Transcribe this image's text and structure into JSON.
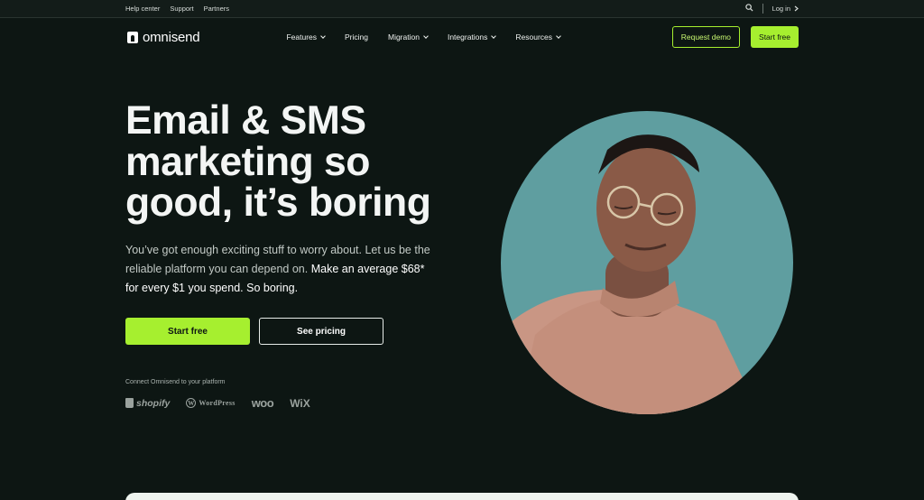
{
  "topbar": {
    "links": [
      "Help center",
      "Support",
      "Partners"
    ],
    "login_label": "Log in"
  },
  "nav": {
    "brand": "omnisend",
    "menu": [
      {
        "label": "Features",
        "dropdown": true
      },
      {
        "label": "Pricing",
        "dropdown": false
      },
      {
        "label": "Migration",
        "dropdown": true
      },
      {
        "label": "Integrations",
        "dropdown": true
      },
      {
        "label": "Resources",
        "dropdown": true
      }
    ],
    "request_demo": "Request demo",
    "start_free": "Start free"
  },
  "hero": {
    "title_line1": "Email & SMS",
    "title_line2": "marketing so",
    "title_line3": "good, it’s boring",
    "subtitle_plain": "You’ve got enough exciting stuff to worry about. Let us be the reliable platform you can depend on.",
    "subtitle_strong": "Make an average $68* for every $1 you spend. So boring.",
    "start_free": "Start free",
    "see_pricing": "See pricing"
  },
  "platforms": {
    "heading": "Connect Omnisend to your platform",
    "items": [
      "shopify",
      "WordPress",
      "woo",
      "WiX"
    ]
  },
  "colors": {
    "background": "#0d1613",
    "accent": "#a6ef2f",
    "portrait_bg": "#5f9ea0"
  },
  "icons": {
    "search": "search-icon",
    "login_arrow": "chevron-right-icon",
    "dropdown": "chevron-down-icon"
  }
}
